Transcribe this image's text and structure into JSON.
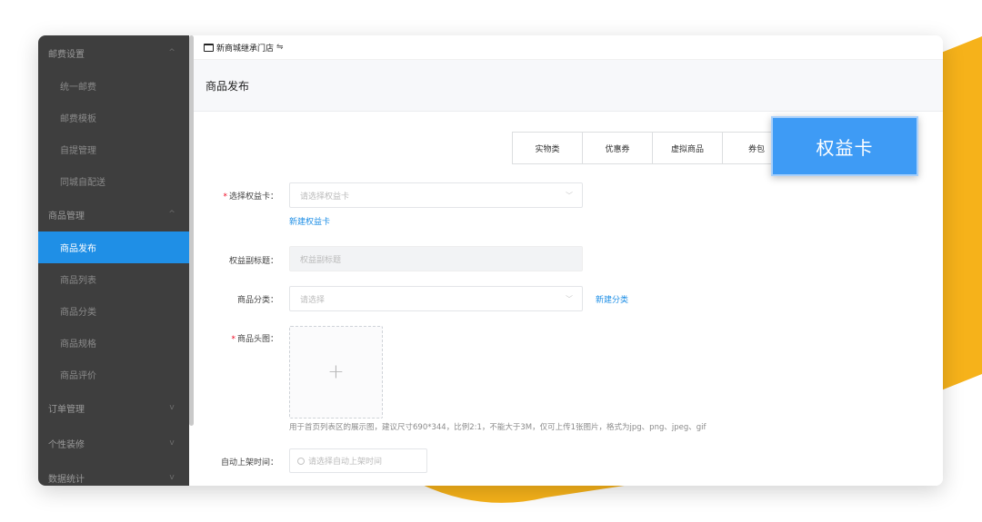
{
  "topbar": {
    "store_name": "新商城继承门店"
  },
  "page_title": "商品发布",
  "sidebar": {
    "items": [
      {
        "label": "邮费设置",
        "type": "group",
        "caret": "^"
      },
      {
        "label": "统一邮费",
        "type": "sub"
      },
      {
        "label": "邮费模板",
        "type": "sub"
      },
      {
        "label": "自提管理",
        "type": "sub"
      },
      {
        "label": "同城自配送",
        "type": "sub"
      },
      {
        "label": "商品管理",
        "type": "group",
        "caret": "^"
      },
      {
        "label": "商品发布",
        "type": "sub",
        "active": true
      },
      {
        "label": "商品列表",
        "type": "sub"
      },
      {
        "label": "商品分类",
        "type": "sub"
      },
      {
        "label": "商品规格",
        "type": "sub"
      },
      {
        "label": "商品评价",
        "type": "sub"
      },
      {
        "label": "订单管理",
        "type": "group",
        "caret": "v"
      },
      {
        "label": "个性装修",
        "type": "group",
        "caret": "v"
      },
      {
        "label": "数据统计",
        "type": "group",
        "caret": "v"
      }
    ]
  },
  "tabs": [
    "实物类",
    "优惠券",
    "虚拟商品",
    "券包"
  ],
  "callout": "权益卡",
  "form": {
    "card": {
      "label": "选择权益卡：",
      "placeholder": "请选择权益卡",
      "link": "新建权益卡"
    },
    "subtitle": {
      "label": "权益副标题：",
      "placeholder": "权益副标题"
    },
    "category": {
      "label": "商品分类：",
      "placeholder": "请选择",
      "link": "新建分类"
    },
    "image": {
      "label": "商品头图：",
      "plus": "+",
      "hint": "用于首页列表区的展示图，建议尺寸690*344，比例2:1，不能大于3M，仅可上传1张图片，格式为jpg、png、jpeg、gif"
    },
    "auto_time": {
      "label": "自动上架时间：",
      "placeholder": "请选择自动上架时间"
    }
  },
  "colors": {
    "accent": "#1f8fe6",
    "sidebar_bg": "#3e3e3e",
    "deco_yellow": "#f6b21a",
    "callout_bg": "#3e9bf5"
  }
}
